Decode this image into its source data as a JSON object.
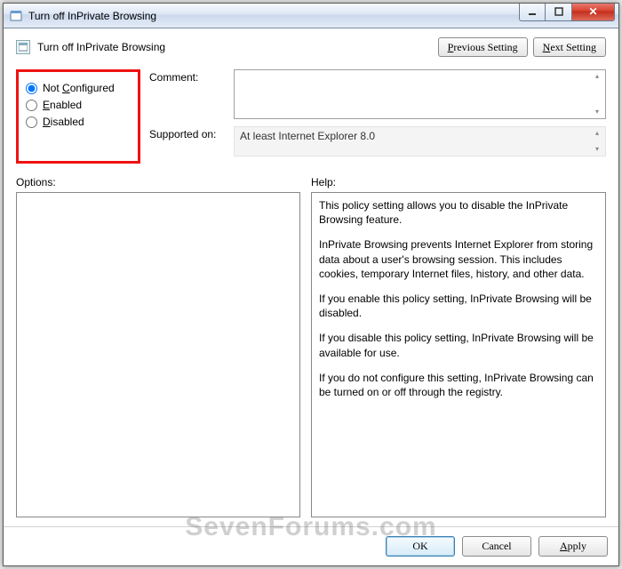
{
  "window": {
    "title": "Turn off InPrivate Browsing"
  },
  "header": {
    "title": "Turn off InPrivate Browsing",
    "prev": "Previous Setting",
    "next": "Next Setting",
    "prev_u": "P",
    "next_u": "N"
  },
  "state": {
    "options": [
      "Not Configured",
      "Enabled",
      "Disabled"
    ],
    "opt_under": [
      "C",
      "E",
      "D"
    ],
    "selected": 0
  },
  "fields": {
    "comment_label": "Comment:",
    "comment_value": "",
    "supported_label": "Supported on:",
    "supported_value": "At least Internet Explorer 8.0"
  },
  "labels": {
    "options": "Options:",
    "help": "Help:"
  },
  "help": [
    "This policy setting allows you to disable the InPrivate Browsing feature.",
    "InPrivate Browsing prevents Internet Explorer from storing data about a user's browsing session. This includes cookies, temporary Internet files, history, and other data.",
    "If you enable this policy setting, InPrivate Browsing will be disabled.",
    "If you disable this policy setting, InPrivate Browsing will be available for use.",
    "If you do not configure this setting, InPrivate Browsing can be turned on or off through the registry."
  ],
  "footer": {
    "ok": "OK",
    "cancel": "Cancel",
    "apply": "Apply",
    "apply_u": "A"
  },
  "watermark": "SevenForums.com"
}
